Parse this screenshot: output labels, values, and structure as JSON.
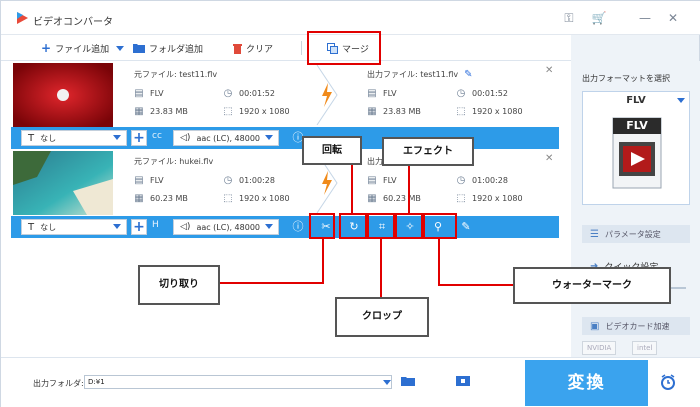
{
  "app": {
    "title": "ビデオコンバータ",
    "window_controls": [
      "key-icon",
      "cart-icon",
      "minimize-icon",
      "close-icon"
    ]
  },
  "toolbar": {
    "add_file": "ファイル追加",
    "add_folder": "フォルダ追加",
    "clear": "クリア",
    "merge": "マージ"
  },
  "files": [
    {
      "source_label": "元ファイル: test11.flv",
      "output_label": "出力ファイル: test11.flv",
      "src": {
        "format": "FLV",
        "duration": "00:01:52",
        "size": "23.83 MB",
        "resolution": "1920 x 1080"
      },
      "out": {
        "format": "FLV",
        "duration": "00:01:52",
        "size": "23.83 MB",
        "resolution": "1920 x 1080"
      },
      "subtitle": "なし",
      "audio": "aac (LC), 48000",
      "thumbnail": "red-video-thumbnail"
    },
    {
      "source_label": "元ファイル: hukei.flv",
      "output_label": "出力ファイル",
      "src": {
        "format": "FLV",
        "duration": "01:00:28",
        "size": "60.23 MB",
        "resolution": "1920 x 1080"
      },
      "out": {
        "format": "FLV",
        "duration": "01:00:28",
        "size": "60.23 MB",
        "resolution": "1920 x 1080"
      },
      "subtitle": "なし",
      "audio": "aac (LC), 48000",
      "thumbnail": "beach-video-thumbnail"
    }
  ],
  "side_panel": {
    "format_title": "出力フォーマットを選択",
    "format_value": "FLV",
    "format_badge": "FLV",
    "param_settings": "パラメータ設定",
    "quick_settings": "クイック設定",
    "gpu_accel": "ビデオカード加速",
    "gpu_vendors": [
      "NVIDIA",
      "intel"
    ]
  },
  "bottom": {
    "output_folder_label": "出力フォルダ:",
    "output_folder_value": "D:¥1",
    "convert_label": "変換"
  },
  "annotations": {
    "rotate": "回転",
    "effect": "エフェクト",
    "cut": "切り取り",
    "crop": "クロップ",
    "watermark": "ウォーターマーク"
  },
  "colors": {
    "accent_blue": "#2d9be8",
    "convert_blue": "#3aa3ee",
    "highlight_red": "#e10000",
    "lightning_orange": "#f08a1a"
  }
}
